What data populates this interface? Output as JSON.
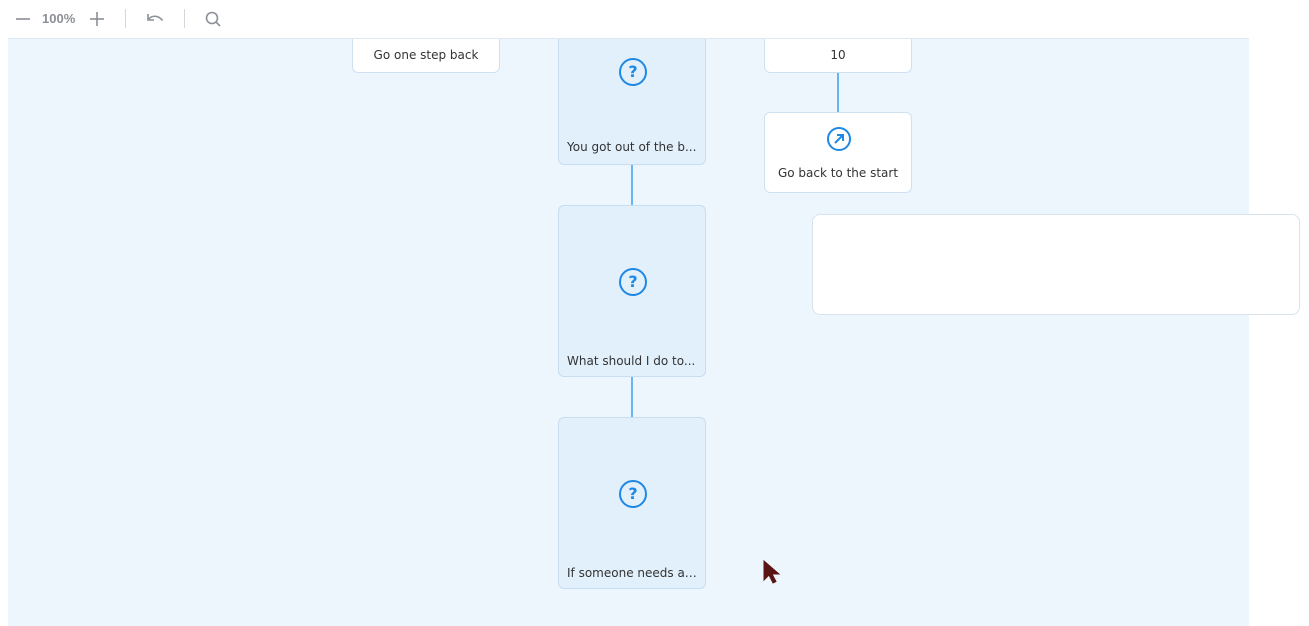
{
  "toolbar": {
    "zoom_level": "100%",
    "zoom_out_icon": "minus-icon",
    "zoom_in_icon": "plus-icon",
    "undo_icon": "undo-icon",
    "search_icon": "search-icon"
  },
  "nodes": {
    "go_one_step_back": "Go one step back",
    "question_1": "You got out of the b...",
    "question_2": "What should I do to...",
    "question_3": "If someone needs a ...",
    "number_node": "10",
    "go_back_start": "Go back to the start"
  },
  "icons": {
    "question": "?",
    "question_icon_name": "question-circle-icon",
    "jump_icon_name": "arrow-up-right-circle-icon"
  },
  "colors": {
    "accent": "#1e88e5",
    "canvas_bg": "#eef6fd",
    "question_node_bg": "#e2f0fc",
    "connector": "#64b5f6"
  }
}
